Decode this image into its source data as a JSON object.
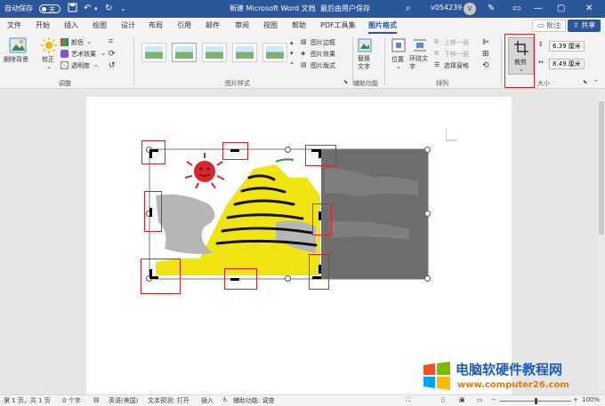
{
  "titlebar": {
    "autosave_label": "自动保存",
    "autosave_state": "关",
    "doc_title": "新建 Microsoft Word 文档",
    "save_status": "最后由用户保存",
    "user_id": "v054239",
    "avatar_initial": "V",
    "colors": {
      "bar": "#2b579a"
    }
  },
  "tabs": {
    "items": [
      "文件",
      "开始",
      "插入",
      "绘图",
      "设计",
      "布局",
      "引用",
      "邮件",
      "审阅",
      "视图",
      "帮助",
      "PDF工具集",
      "图片格式"
    ],
    "active": "图片格式",
    "comment_button": "批注",
    "share_button": "共享"
  },
  "ribbon": {
    "adjust": {
      "remove_bg": "删除背景",
      "correct": "校正",
      "color": "颜色",
      "artistic": "艺术效果",
      "transparency": "透明度",
      "group": "调整"
    },
    "styles": {
      "border": "图片边框",
      "effects": "图片效果",
      "layout": "图片版式",
      "group": "图片样式"
    },
    "accessibility": {
      "alt_text": "替换文字",
      "group": "辅助功能"
    },
    "arrange": {
      "position": "位置",
      "wrap_text": "环绕文字",
      "bring_forward": "上移一层",
      "send_backward": "下移一层",
      "selection_pane": "选择窗格",
      "group": "排列"
    },
    "size": {
      "crop": "裁剪",
      "height": "6.39 厘米",
      "width": "8.49 厘米",
      "group": "大小"
    }
  },
  "status": {
    "page": "第 1 页，共 1 页",
    "words": "0 个字",
    "language": "英语(美国)",
    "predict": "文本预测: 打开",
    "insert": "插入",
    "accessibility": "辅助功能: 调查",
    "zoom": "100%"
  },
  "watermark": {
    "title": "电脑软硬件教程网",
    "url": "www.computer26.com",
    "colors": {
      "title": "#1a5fb4",
      "url": "#e07b00",
      "logo_red": "#f25022",
      "logo_green": "#7fba00",
      "logo_blue": "#00a4ef",
      "logo_yellow": "#ffb900"
    }
  }
}
